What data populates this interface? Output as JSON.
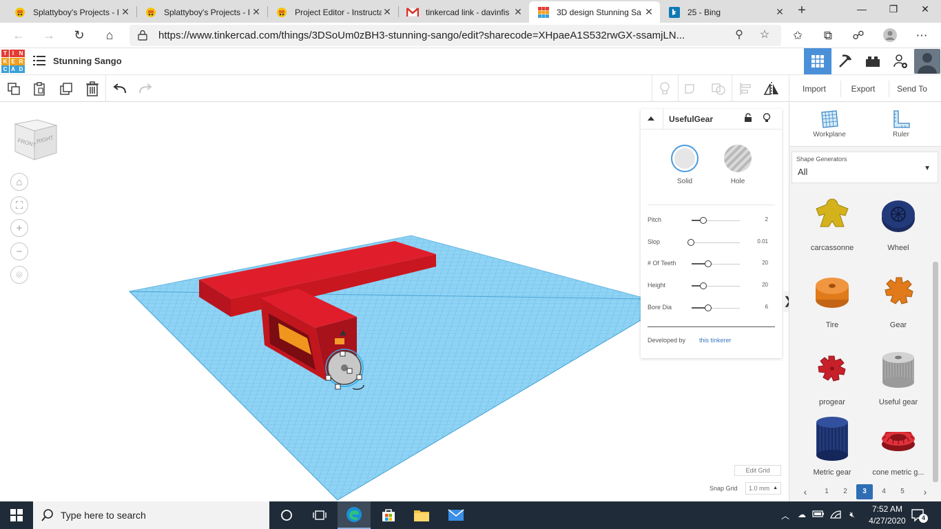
{
  "browser": {
    "tabs": [
      {
        "title": "Splattyboy's Projects - I",
        "icon": "instructables-icon",
        "active": false
      },
      {
        "title": "Splattyboy's Projects - I",
        "icon": "instructables-icon",
        "active": false
      },
      {
        "title": "Project Editor - Instructa",
        "icon": "instructables-icon",
        "active": false
      },
      {
        "title": "tinkercad link - davinfis",
        "icon": "gmail-icon",
        "active": false
      },
      {
        "title": "3D design Stunning Sa",
        "icon": "tinkercad-icon",
        "active": true
      },
      {
        "title": "25 - Bing",
        "icon": "bing-icon",
        "active": false
      }
    ],
    "new_tab": "+",
    "url": "https://www.tinkercad.com/things/3DSoUm0zBH3-stunning-sango/edit?sharecode=XHpaeA1S532rwGX-ssamjLN..."
  },
  "app": {
    "logo_letters": [
      "T",
      "I",
      "N",
      "K",
      "E",
      "R",
      "C",
      "A",
      "D"
    ],
    "logo_colors": [
      "#e33d35",
      "#e33d35",
      "#e33d35",
      "#f0a020",
      "#f0a020",
      "#f0a020",
      "#3ba0d8",
      "#3ba0d8",
      "#3ba0d8"
    ],
    "design_title": "Stunning Sango"
  },
  "toolbar": {
    "import_label": "Import",
    "export_label": "Export",
    "send_to_label": "Send To"
  },
  "inspector": {
    "title": "UsefulGear",
    "solid_label": "Solid",
    "hole_label": "Hole",
    "params": [
      {
        "label": "Pitch",
        "value": "2",
        "fraction": 0.17
      },
      {
        "label": "Slop",
        "value": "0.01",
        "fraction": 0.0
      },
      {
        "label": "# Of Teeth",
        "value": "20",
        "fraction": 0.27
      },
      {
        "label": "Height",
        "value": "20",
        "fraction": 0.17
      },
      {
        "label": "Bore Dia",
        "value": "6",
        "fraction": 0.27
      }
    ],
    "developed_by_label": "Developed by",
    "developer_link": "this tinkerer"
  },
  "right_panel": {
    "workplane_label": "Workplane",
    "ruler_label": "Ruler",
    "shape_generators_label": "Shape Generators",
    "shape_generators_value": "All",
    "shapes": [
      {
        "label": "carcassonne",
        "color": "#d4b21c"
      },
      {
        "label": "Wheel",
        "color": "#233a7a"
      },
      {
        "label": "Tire",
        "color": "#e07a1a"
      },
      {
        "label": "Gear",
        "color": "#e07a1a"
      },
      {
        "label": "progear",
        "color": "#c8202a"
      },
      {
        "label": "Useful gear",
        "color": "#b5b5b5"
      },
      {
        "label": "Metric gear",
        "color": "#233a7a"
      },
      {
        "label": "cone metric g...",
        "color": "#c8202a"
      }
    ],
    "pages": [
      "1",
      "2",
      "3",
      "4",
      "5"
    ],
    "current_page": "3"
  },
  "grid": {
    "edit_grid_label": "Edit Grid",
    "snap_grid_label": "Snap Grid",
    "snap_grid_value": "1.0 mm"
  },
  "viewcube": {
    "front_label": "FRONT",
    "right_label": "RIGHT"
  },
  "taskbar": {
    "search_placeholder": "Type here to search",
    "time": "7:52 AM",
    "date": "4/27/2020",
    "notification_count": "4"
  },
  "colors": {
    "accent": "#4a90d9",
    "workplane": "#6ec6f0",
    "model_red": "#e01e2b"
  }
}
